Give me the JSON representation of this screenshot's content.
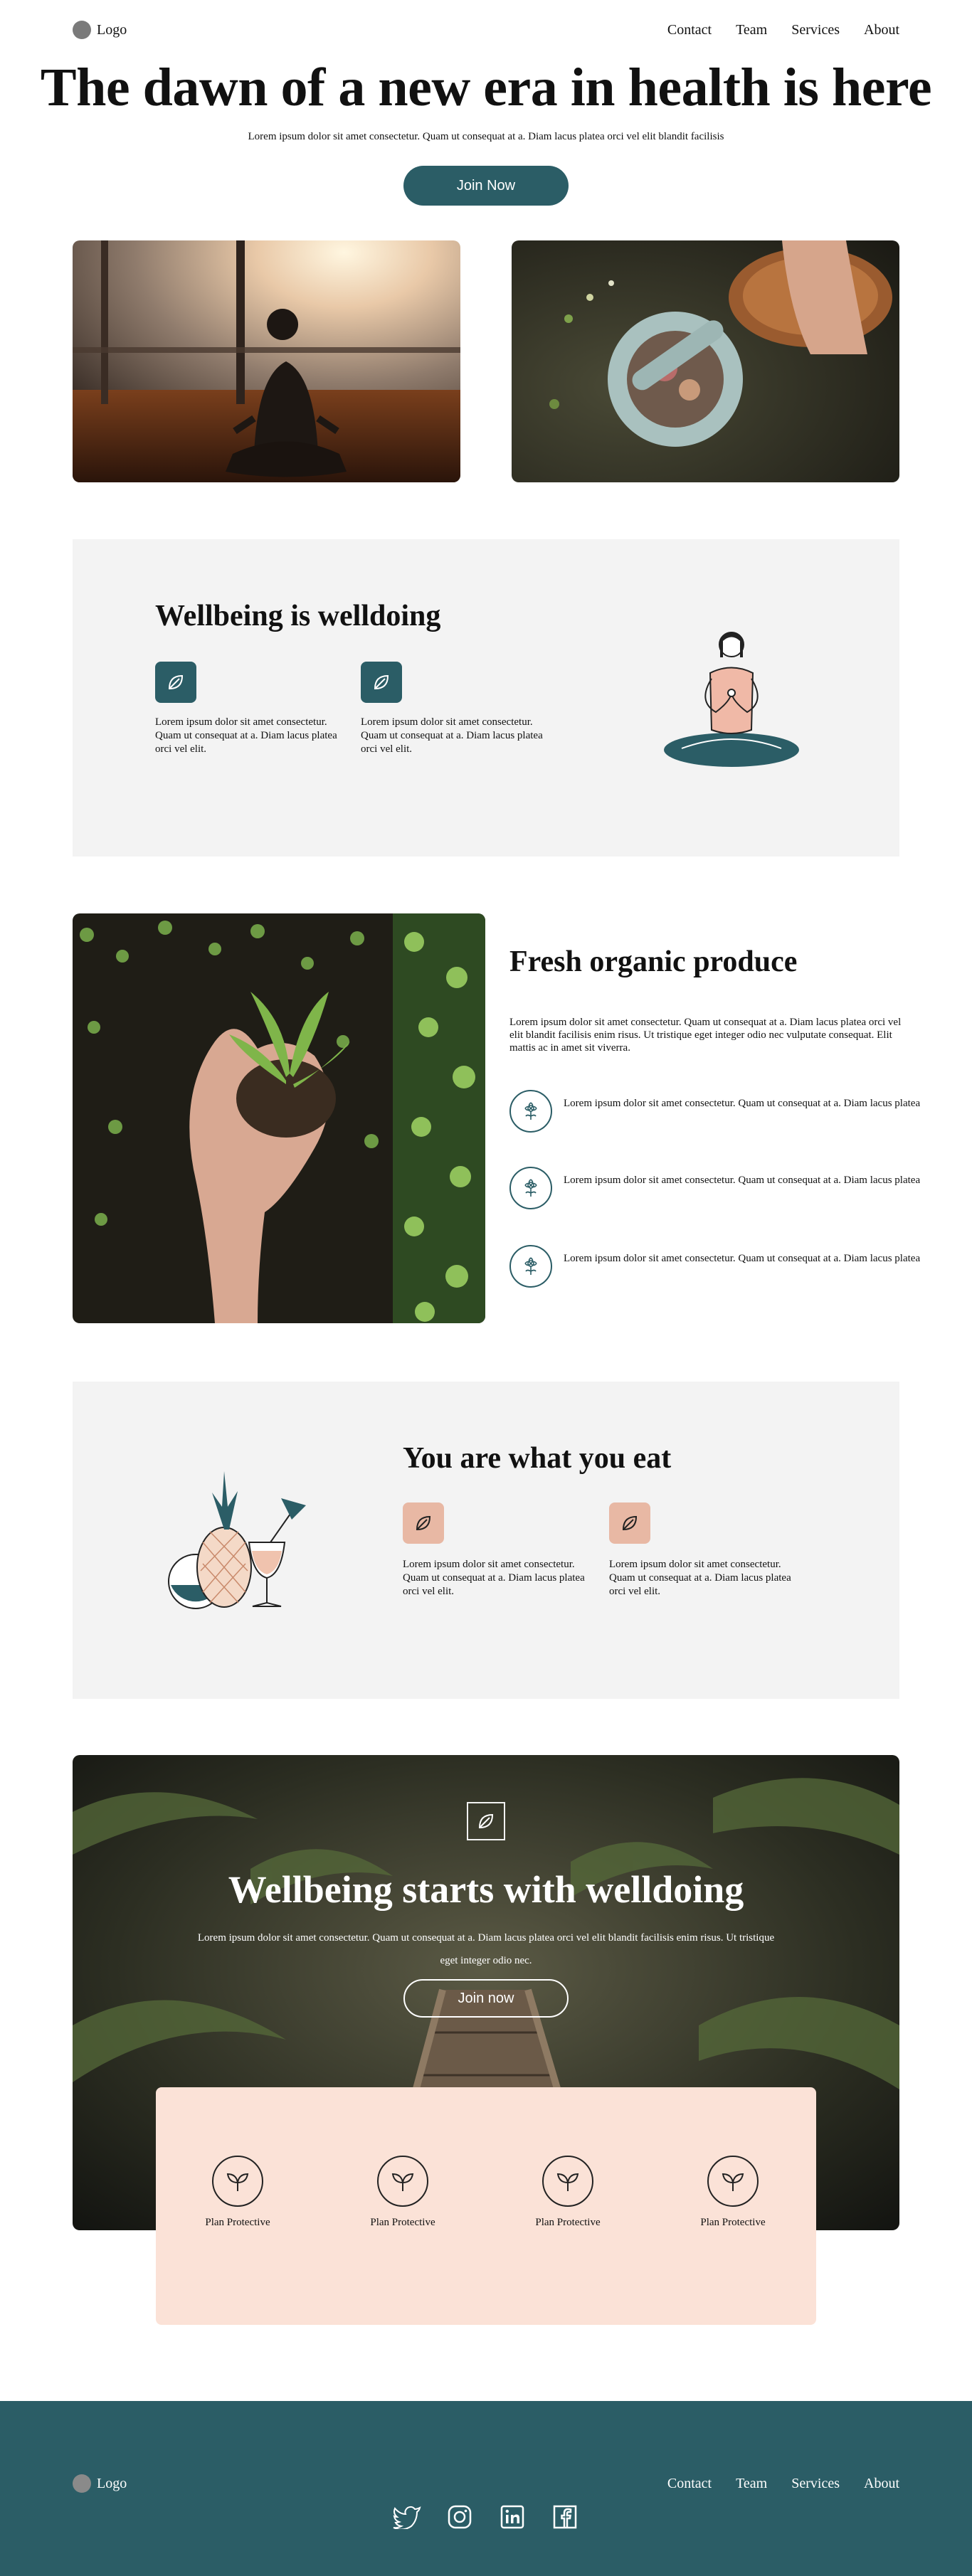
{
  "header": {
    "logo_text": "Logo",
    "nav": [
      "Contact",
      "Team",
      "Services",
      "About"
    ]
  },
  "hero": {
    "title": "The dawn of a new era in health is here",
    "subtitle": "Lorem ipsum dolor sit amet consectetur. Quam ut consequat at a. Diam lacus platea orci vel elit blandit facilisis",
    "cta_label": "Join Now"
  },
  "wellbeing": {
    "title": "Wellbeing is welldoing",
    "features": [
      {
        "icon": "leaf-icon",
        "text": "Lorem ipsum dolor sit amet consectetur. Quam ut consequat at a. Diam lacus platea orci vel elit."
      },
      {
        "icon": "leaf-icon",
        "text": "Lorem ipsum dolor sit amet consectetur. Quam ut consequat at a. Diam lacus platea orci vel elit."
      }
    ],
    "illustration": "meditating-woman-illustration"
  },
  "produce": {
    "title": "Fresh organic produce",
    "description": "Lorem ipsum dolor sit amet consectetur. Quam ut consequat at a. Diam lacus platea orci vel elit blandit facilisis enim risus. Ut tristique eget integer odio nec vulputate consequat. Elit mattis ac in amet sit viverra.",
    "bullets": [
      {
        "icon": "flower-icon",
        "text": "Lorem ipsum dolor sit amet consectetur. Quam ut consequat at a. Diam lacus platea"
      },
      {
        "icon": "flower-icon",
        "text": "Lorem ipsum dolor sit amet consectetur. Quam ut consequat at a. Diam lacus platea"
      },
      {
        "icon": "flower-icon",
        "text": "Lorem ipsum dolor sit amet consectetur. Quam ut consequat at a. Diam lacus platea"
      }
    ]
  },
  "eat": {
    "title": "You are what you eat",
    "features": [
      {
        "icon": "leaf-icon",
        "text": "Lorem ipsum dolor sit amet consectetur. Quam ut consequat at a. Diam lacus platea orci vel elit."
      },
      {
        "icon": "leaf-icon",
        "text": "Lorem ipsum dolor sit amet consectetur. Quam ut consequat at a. Diam lacus platea orci vel elit."
      }
    ],
    "illustration": "pineapple-cocktail-illustration"
  },
  "banner": {
    "title": "Wellbeing starts with welldoing",
    "subtitle": "Lorem ipsum dolor sit amet consectetur. Quam ut consequat at a. Diam lacus platea orci vel elit blandit facilisis enim risus. Ut tristique eget integer odio nec.",
    "cta_label": "Join now"
  },
  "plans": [
    {
      "icon": "sprout-icon",
      "label": "Plan Protective"
    },
    {
      "icon": "sprout-icon",
      "label": "Plan Protective"
    },
    {
      "icon": "sprout-icon",
      "label": "Plan Protective"
    },
    {
      "icon": "sprout-icon",
      "label": "Plan Protective"
    }
  ],
  "footer": {
    "logo_text": "Logo",
    "nav": [
      "Contact",
      "Team",
      "Services",
      "About"
    ],
    "socials": [
      "twitter-icon",
      "instagram-icon",
      "linkedin-icon",
      "facebook-icon"
    ]
  },
  "colors": {
    "brand_teal": "#2b5d66",
    "panel_gray": "#f3f3f3",
    "peach": "#fbe2d7",
    "accent_peach_icon": "#e8b8a4"
  }
}
